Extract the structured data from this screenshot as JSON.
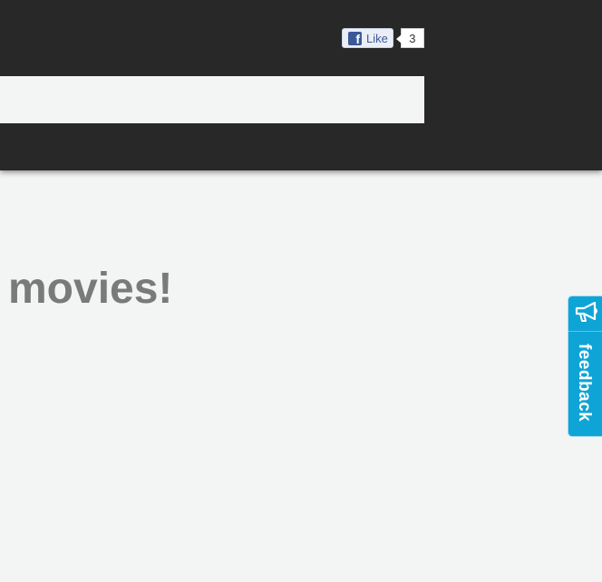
{
  "header": {
    "facebook_like": {
      "label": "Like",
      "count": "3"
    },
    "search": {
      "value": "",
      "placeholder": ""
    }
  },
  "main": {
    "headline": "movies!"
  },
  "feedback_tab": {
    "label": "feedback",
    "icon": "megaphone-icon"
  },
  "colors": {
    "header_bg": "#282828",
    "page_bg": "#f3f5f5",
    "headline": "#7a7a7a",
    "feedback_bg": "#0ea4d6",
    "facebook_blue": "#3b5998"
  }
}
